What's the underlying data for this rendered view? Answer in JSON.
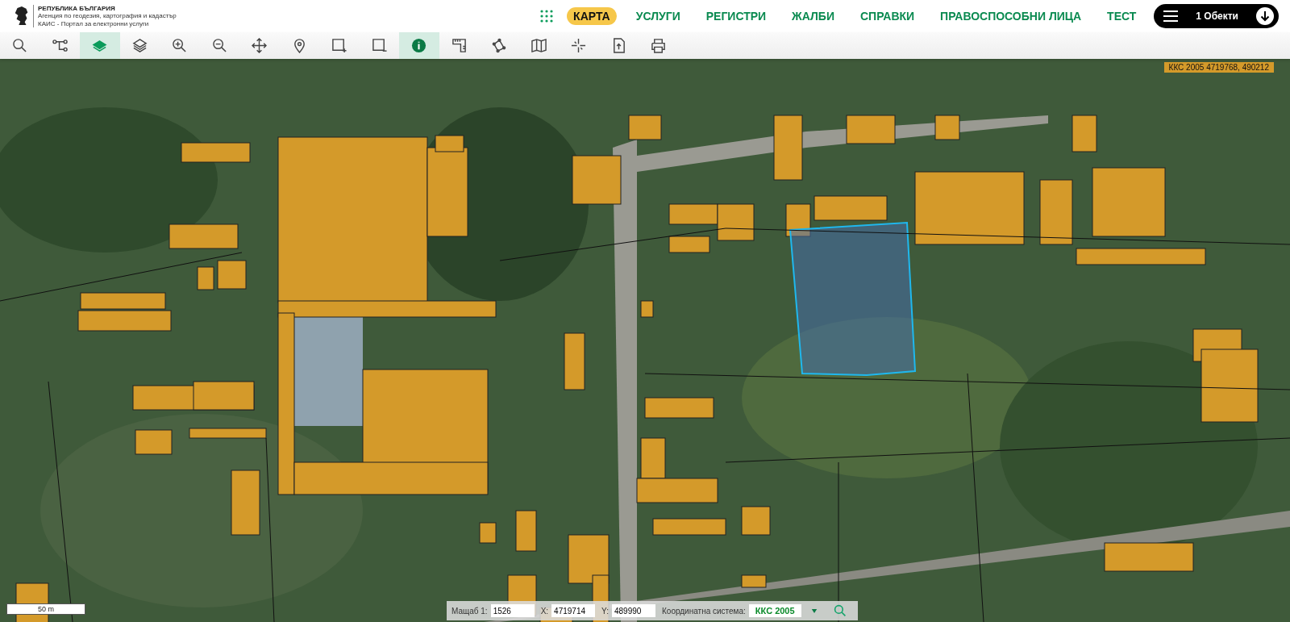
{
  "header": {
    "logo_title": "РЕПУБЛИКА БЪЛГАРИЯ",
    "logo_subtitle": "Агенция по геодезия, картография и кадастър",
    "logo_caption": "КАИС - Портал за електронни услуги"
  },
  "nav": [
    {
      "label": "КАРТА",
      "selected": true
    },
    {
      "label": "УСЛУГИ",
      "selected": false
    },
    {
      "label": "РЕГИСТРИ",
      "selected": false
    },
    {
      "label": "ЖАЛБИ",
      "selected": false
    },
    {
      "label": "СПРАВКИ",
      "selected": false
    },
    {
      "label": "ПРАВОСПОСОБНИ ЛИЦА",
      "selected": false
    },
    {
      "label": "ТЕСТ",
      "selected": false
    }
  ],
  "objects_button": {
    "label": "1 Обекти"
  },
  "toolbar": [
    {
      "kind": "search",
      "selected": false
    },
    {
      "kind": "route",
      "selected": false
    },
    {
      "kind": "layers-filled",
      "selected": true
    },
    {
      "kind": "layers",
      "selected": false
    },
    {
      "kind": "zoom-in",
      "selected": false
    },
    {
      "kind": "zoom-out",
      "selected": false
    },
    {
      "kind": "move",
      "selected": false
    },
    {
      "kind": "pin",
      "selected": false
    },
    {
      "kind": "rect-plus",
      "selected": false
    },
    {
      "kind": "rect-minus",
      "selected": false
    },
    {
      "kind": "info",
      "selected": true
    },
    {
      "kind": "ruler",
      "selected": false
    },
    {
      "kind": "polygon",
      "selected": false
    },
    {
      "kind": "map",
      "selected": false
    },
    {
      "kind": "crosshair",
      "selected": false
    },
    {
      "kind": "document",
      "selected": false
    },
    {
      "kind": "print",
      "selected": false
    }
  ],
  "map": {
    "cursor_coordinates": "ККС 2005 4719768, 490212",
    "scale_bar": "50 m"
  },
  "status_bar": {
    "scale_label": "Мащаб 1:",
    "scale_value": "1526",
    "x_label": "X:",
    "x_value": "4719714",
    "y_label": "Y:",
    "y_value": "489990",
    "crs_label": "Координатна система:",
    "crs_value": "ККС 2005"
  }
}
